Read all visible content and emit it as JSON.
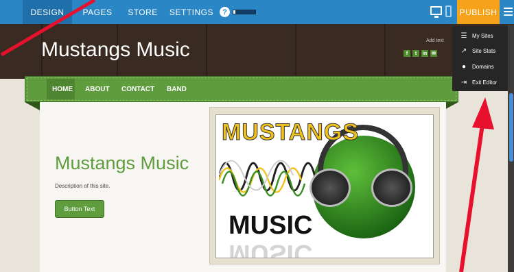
{
  "toolbar": {
    "tabs": [
      "DESIGN",
      "PAGES",
      "STORE",
      "SETTINGS"
    ],
    "help_icon_glyph": "?",
    "upload_progress": 0.1,
    "publish_label": "PUBLISH"
  },
  "header": {
    "site_title": "Mustangs Music",
    "add_text": "Add text",
    "social": [
      "f",
      "t",
      "in",
      "✉"
    ]
  },
  "nav": {
    "items": [
      "HOME",
      "ABOUT",
      "CONTACT",
      "BAND"
    ]
  },
  "hero": {
    "title": "Mustangs Music",
    "description": "Description of this site.",
    "button_label": "Button Text"
  },
  "logo_image": {
    "word_top": "MUSTANGS",
    "word_bottom": "MUSIC"
  },
  "dropdown": {
    "items": [
      {
        "label": "My Sites",
        "icon": "list-icon"
      },
      {
        "label": "Site Stats",
        "icon": "trend-icon"
      },
      {
        "label": "Domains",
        "icon": "globe-icon"
      },
      {
        "label": "Exit Editor",
        "icon": "exit-icon"
      }
    ]
  },
  "colors": {
    "toolbar_blue": "#2b86c6",
    "publish_orange": "#f6a21b",
    "brand_green": "#5f9c3e",
    "annotation_red": "#e8112d"
  }
}
